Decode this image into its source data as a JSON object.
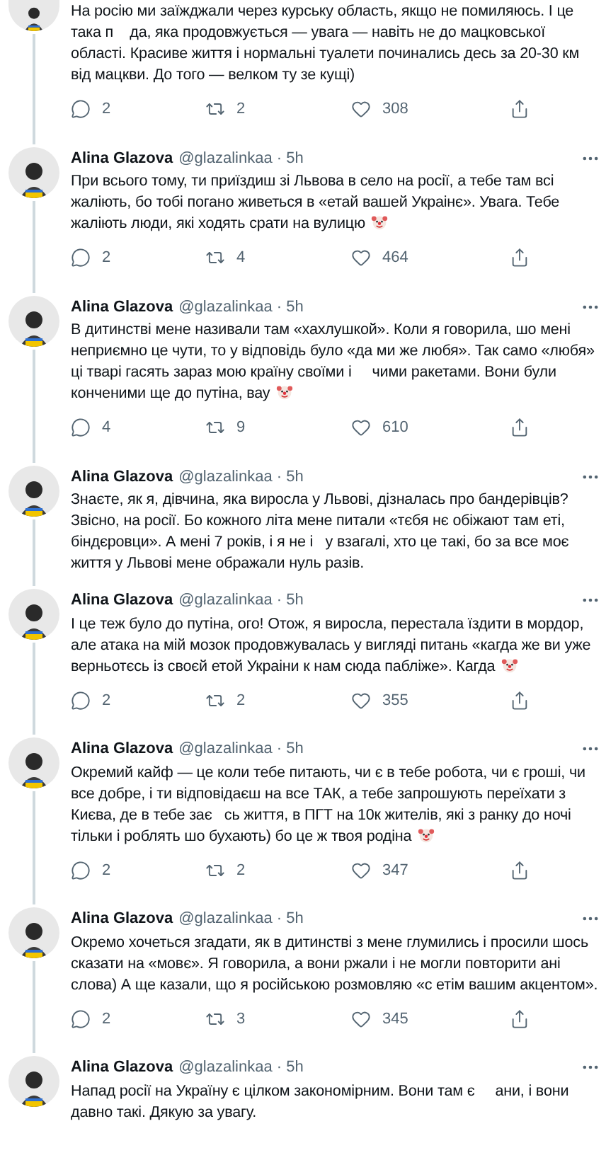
{
  "tweets": [
    {
      "text": "На росію ми заїжджали через курську область, якщо не помиляюсь. І це така п    да, яка продовжується — увага — навіть не до мацковської області. Красиве життя і нормальні туалети починались десь за 20-30 км від мацкви. До того — велком ту зе кущі)",
      "emoji": false,
      "stats": {
        "replies": "2",
        "retweets": "2",
        "likes": "308"
      }
    },
    {
      "author": "Alina Glazova",
      "handle": "@glazalinkaa · 5h",
      "text": "При всього тому, ти приїздиш зі Львова в село на росії, а тебе там всі жаліють, бо тобі погано живеться в «етай вашей Украінє». Увага. Тебе жаліють люди, які ходять срати на вулицю",
      "emoji": true,
      "stats": {
        "replies": "2",
        "retweets": "4",
        "likes": "464"
      }
    },
    {
      "author": "Alina Glazova",
      "handle": "@glazalinkaa · 5h",
      "text": "В дитинстві мене називали там «хахлушкой». Коли я говорила, шо мені неприємно це чути, то у відповідь було «да ми же любя». Так само «любя» ці тварі гасять зараз мою країну своїми і     чими ракетами. Вони були конченими ще до путіна, вау",
      "emoji": true,
      "stats": {
        "replies": "4",
        "retweets": "9",
        "likes": "610"
      }
    },
    {
      "author": "Alina Glazova",
      "handle": "@glazalinkaa · 5h",
      "text": "Знаєте, як я, дівчина, яка виросла у Львові, дізналась про бандерівців? Звісно, на росії. Бо кожного літа мене питали «тєбя нє обіжают там еті, біндєровци». А мені 7 років, і я не і   у взагалі, хто це такі, бо за все моє життя у Львові мене ображали нуль разів.",
      "emoji": false
    },
    {
      "author": "Alina Glazova",
      "handle": "@glazalinkaa · 5h",
      "text": "І це теж було до путіна, ого! Отож, я виросла, перестала їздити в мордор, але атака на мій мозок продовжувалась у вигляді питань «кагда же ви уже верньотєсь із своєй етой Украіни к нам сюда пабліже». Кагда",
      "emoji": true,
      "stats": {
        "replies": "2",
        "retweets": "2",
        "likes": "355"
      }
    },
    {
      "author": "Alina Glazova",
      "handle": "@glazalinkaa · 5h",
      "text": "Окремий кайф — це коли тебе питають, чи є в тебе робота, чи є гроші, чи все добре, і ти відповідаєш на все ТАК, а тебе запрошують переїхати з Києва, де в тебе зає   сь життя, в ПГТ на 10к жителів, які з ранку до ночі тільки і роблять шо бухають) бо це ж твоя родіна",
      "emoji": true,
      "stats": {
        "replies": "2",
        "retweets": "2",
        "likes": "347"
      }
    },
    {
      "author": "Alina Glazova",
      "handle": "@glazalinkaa · 5h",
      "text": "Окремо хочеться згадати, як в дитинстві з мене глумились і просили шось сказати на «мовє». Я говорила, а вони ржали і не могли повторити ані слова) А ще казали, що я російською розмовляю «с етім вашим акцентом».",
      "emoji": false,
      "stats": {
        "replies": "2",
        "retweets": "3",
        "likes": "345"
      }
    },
    {
      "author": "Alina Glazova",
      "handle": "@glazalinkaa · 5h",
      "text": "Напад росії на Україну є цілком закономірним. Вони там є     ани, і вони давно такі. Дякую за увагу.",
      "emoji": false
    }
  ]
}
